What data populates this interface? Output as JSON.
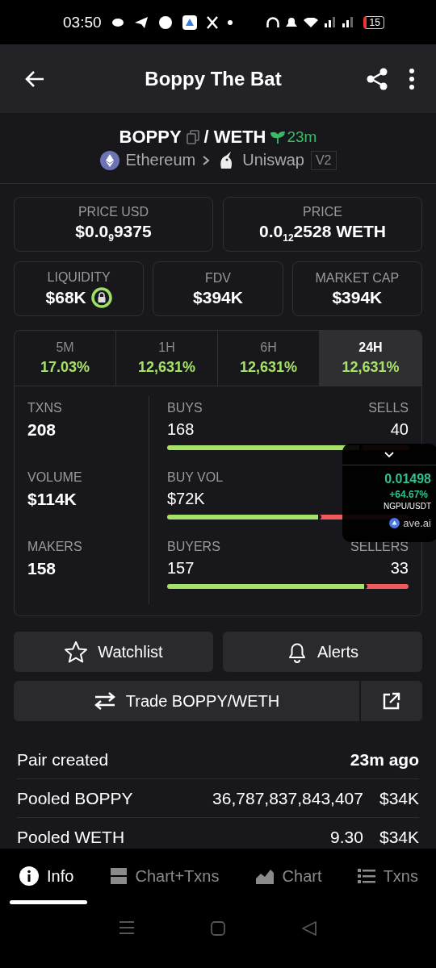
{
  "status_bar": {
    "time": "03:50",
    "battery": "15"
  },
  "header": {
    "title": "Boppy The Bat"
  },
  "pair": {
    "base": "BOPPY",
    "separator": "/",
    "quote": "WETH",
    "age": "23m",
    "chain": "Ethereum",
    "dex": "Uniswap",
    "version": "V2"
  },
  "price_cards": [
    {
      "label": "PRICE USD",
      "value": "$0.0$_{9}$9375"
    },
    {
      "label": "PRICE",
      "value": "0.0$_{12}$2528 WETH"
    }
  ],
  "metric_cards": [
    {
      "label": "LIQUIDITY",
      "value": "$68K",
      "locked": true
    },
    {
      "label": "FDV",
      "value": "$394K",
      "locked": false
    },
    {
      "label": "MARKET CAP",
      "value": "$394K",
      "locked": false
    }
  ],
  "timeframes": [
    {
      "label": "5M",
      "change": "17.03%",
      "selected": false
    },
    {
      "label": "1H",
      "change": "12,631%",
      "selected": false
    },
    {
      "label": "6H",
      "change": "12,631%",
      "selected": false
    },
    {
      "label": "24H",
      "change": "12,631%",
      "selected": true
    }
  ],
  "stats": [
    {
      "label": "TXNS",
      "value": "208",
      "left_label": "BUYS",
      "left_value": "168",
      "right_label": "SELLS",
      "right_value": "40",
      "level": 0.81
    },
    {
      "label": "VOLUME",
      "value": "$114K",
      "left_label": "BUY VOL",
      "left_value": "$72K",
      "level": 0.64
    },
    {
      "label": "MAKERS",
      "value": "158",
      "left_label": "BUYERS",
      "left_value": "157",
      "right_label": "SELLERS",
      "right_value": "33",
      "level": 0.83
    }
  ],
  "overlay": {
    "price": "0.01498",
    "change": "+64.67%",
    "pair": "NGPU/USDT",
    "source": "ave.ai"
  },
  "actions": [
    {
      "label": "Watchlist",
      "kind": "star"
    },
    {
      "label": "Alerts",
      "kind": "bell"
    }
  ],
  "trade_button": {
    "label": "Trade BOPPY/WETH"
  },
  "info_rows": [
    {
      "label": "Pair created",
      "amount": "23m ago",
      "kind": "bold"
    },
    {
      "label": "Pooled BOPPY",
      "amount": "36,787,837,843,407",
      "usd": "$34K",
      "kind": "pooled"
    },
    {
      "label": "Pooled WETH",
      "amount": "9.30",
      "usd": "$34K",
      "kind": "pooled"
    }
  ],
  "bottom_tabs": [
    {
      "label": "Info",
      "selected": true
    },
    {
      "label": "Chart+Txns",
      "selected": false
    },
    {
      "label": "Chart",
      "selected": false
    },
    {
      "label": "Txns",
      "selected": false
    }
  ]
}
